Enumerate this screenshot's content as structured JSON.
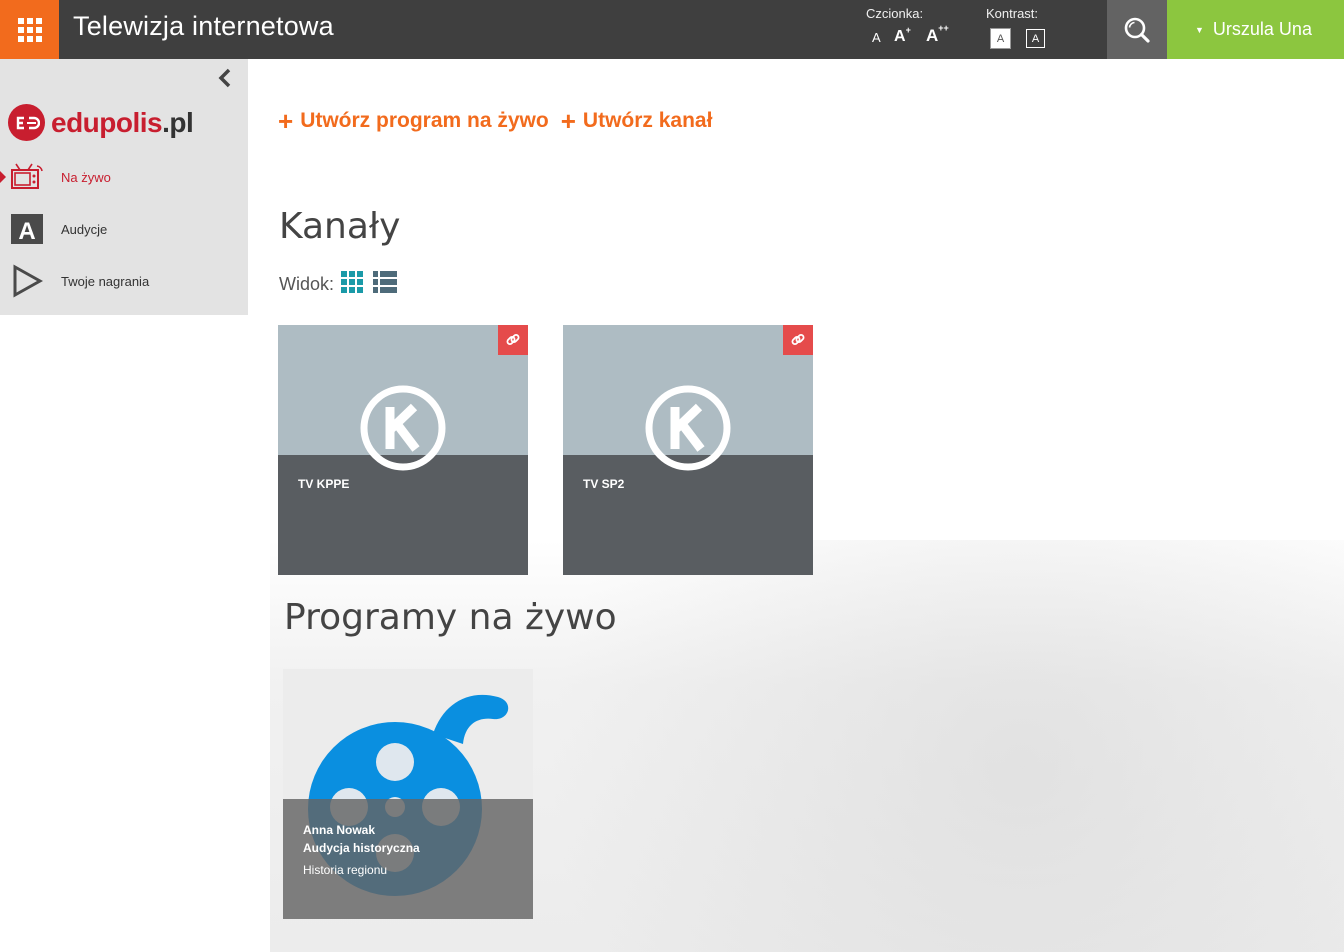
{
  "topbar": {
    "title": "Telewizja internetowa",
    "font_label": "Czcionka:",
    "font_sizes": [
      "A",
      "A",
      "A"
    ],
    "font_sup": [
      "",
      "+",
      "++"
    ],
    "contrast_label": "Kontrast:",
    "contrast_options": [
      "A",
      "A"
    ],
    "user_name": "Urszula Una",
    "colors": {
      "apps": "#f26b1d",
      "user": "#8cc63f",
      "bar": "#3f3f3f"
    }
  },
  "sidebar": {
    "logo_text_main": "edupolis",
    "logo_text_tail": ".pl",
    "items": [
      {
        "label": "Na żywo",
        "icon": "tv-icon",
        "active": true
      },
      {
        "label": "Audycje",
        "icon": "letter-a-icon",
        "active": false
      },
      {
        "label": "Twoje nagrania",
        "icon": "play-icon",
        "active": false
      }
    ]
  },
  "actions": {
    "create_program": "Utwórz program na żywo",
    "create_channel": "Utwórz kanał"
  },
  "channels": {
    "title": "Kanały",
    "view_label": "Widok:",
    "items": [
      {
        "name": "TV KPPE"
      },
      {
        "name": "TV SP2"
      }
    ]
  },
  "programs": {
    "title": "Programy na żywo",
    "items": [
      {
        "author": "Anna Nowak",
        "title": "Audycja historyczna",
        "category": "Historia regionu"
      }
    ]
  }
}
